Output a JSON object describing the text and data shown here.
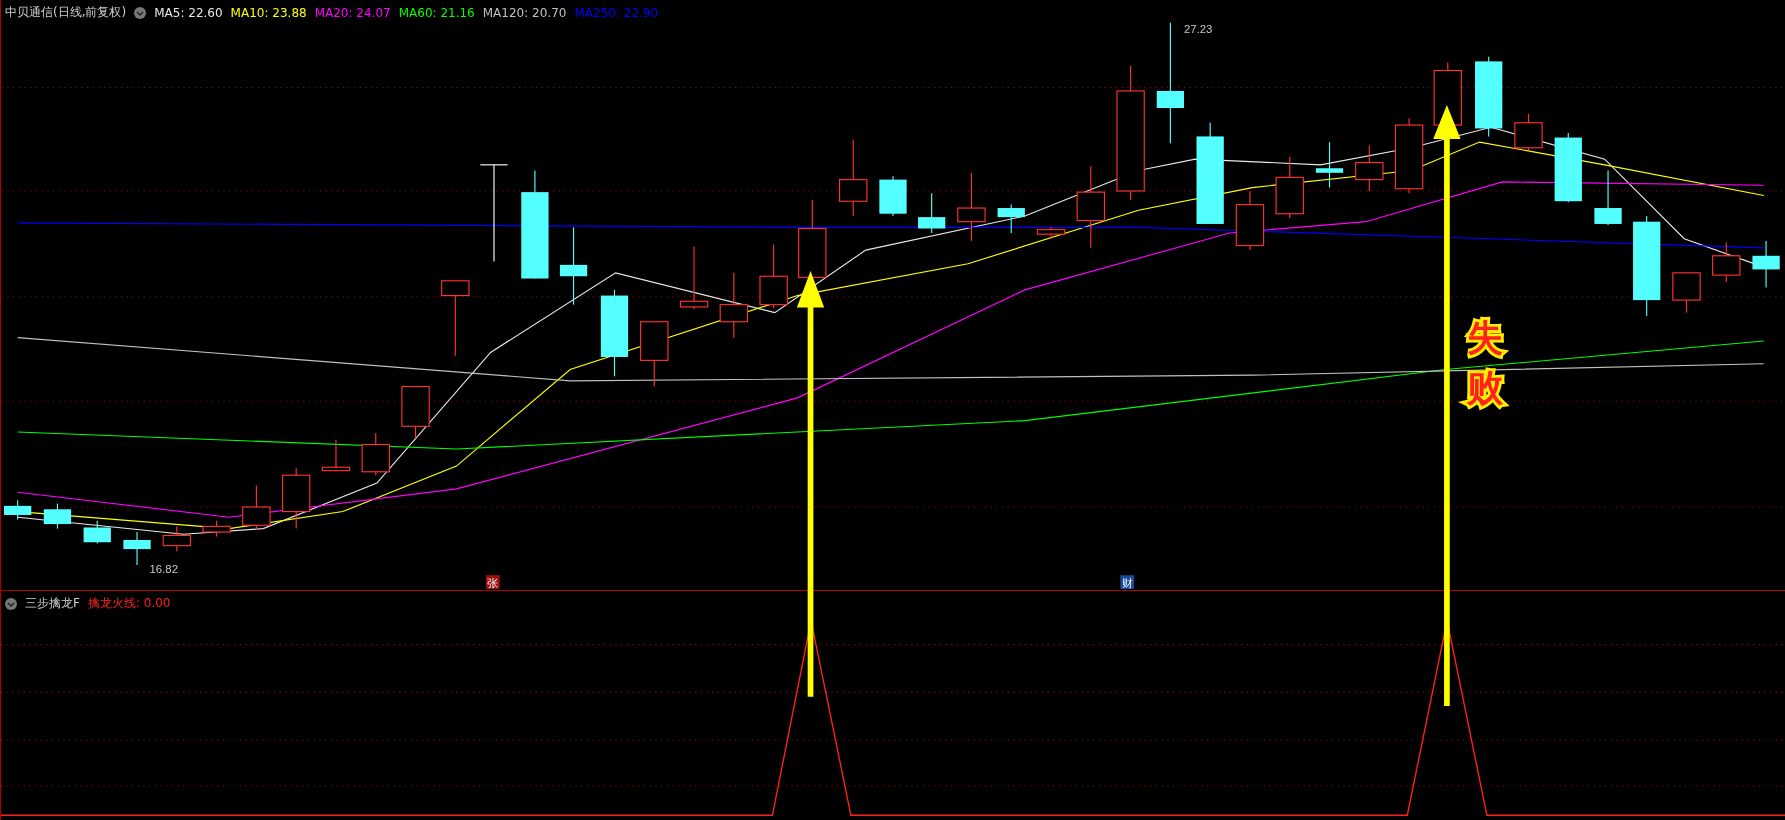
{
  "main_panel": {
    "title": "中贝通信(日线,前复权)",
    "indicators": [
      {
        "label": "MA5: 22.60",
        "color": "#e8e8e8"
      },
      {
        "label": "MA10: 23.88",
        "color": "#ffff00"
      },
      {
        "label": "MA20: 24.07",
        "color": "#ff00ff"
      },
      {
        "label": "MA60: 21.16",
        "color": "#00ff00"
      },
      {
        "label": "MA120: 20.70",
        "color": "#c0c0c0"
      },
      {
        "label": "MA250: 22.90",
        "color": "#0000ff"
      }
    ],
    "high_label": "27.23",
    "low_label": "16.82",
    "markers": [
      {
        "text": "张",
        "color": "#a01010"
      },
      {
        "text": "财",
        "color": "#1a4a9a"
      }
    ],
    "annotation": [
      "失",
      "败"
    ]
  },
  "sub_panel": {
    "title": "三步擒龙F",
    "indicators": [
      {
        "label": "擒龙火线: 0.00",
        "color": "#ff2020"
      }
    ]
  }
}
